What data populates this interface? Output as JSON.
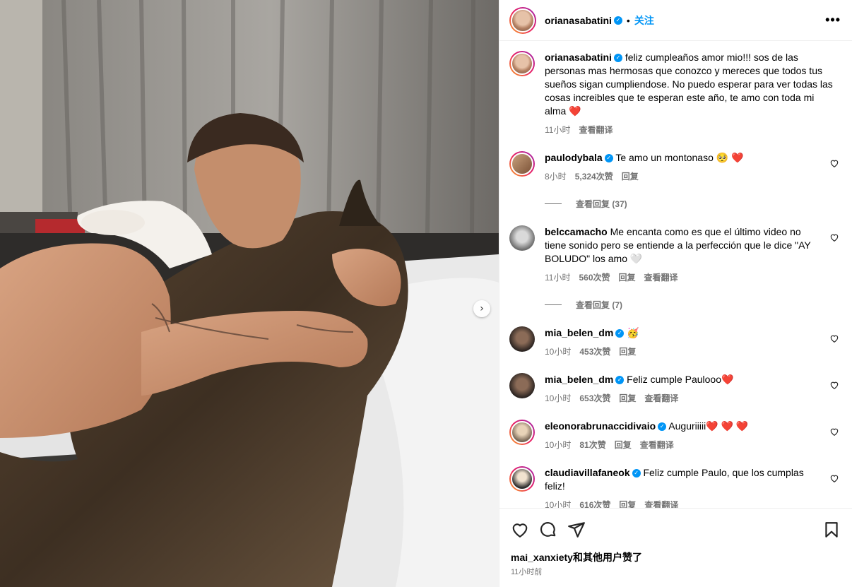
{
  "post": {
    "username": "orianasabatini",
    "follow_label": "关注",
    "more_label": "•••",
    "dot": "•"
  },
  "caption": {
    "username": "orianasabatini",
    "text": "feliz cumpleaños amor mio!!! sos de las personas mas hermosas que conozco y mereces que todos tus sueños sigan cumpliendose. No puedo esperar para ver todas las cosas increibles que te esperan este año, te amo con toda mi alma ❤️",
    "time": "11小时",
    "translate": "查看翻译"
  },
  "comments": [
    {
      "username": "paulodybala",
      "text": "Te amo un montonaso 🥺 ❤️",
      "time": "8小时",
      "likes": "5,324次赞",
      "reply": "回复",
      "translate": "",
      "view_replies": "查看回复 (37)"
    },
    {
      "username": "belccamacho",
      "text": "Me encanta como es que el último video no tiene sonido pero se entiende a la perfección que le dice \"AY BOLUDO\" los amo 🤍",
      "time": "11小时",
      "likes": "560次赞",
      "reply": "回复",
      "translate": "查看翻译",
      "view_replies": "查看回复 (7)"
    },
    {
      "username": "mia_belen_dm",
      "text": "🥳",
      "time": "10小时",
      "likes": "453次赞",
      "reply": "回复",
      "translate": "",
      "view_replies": ""
    },
    {
      "username": "mia_belen_dm",
      "text": "Feliz cumple Paulooo❤️",
      "time": "10小时",
      "likes": "653次赞",
      "reply": "回复",
      "translate": "查看翻译",
      "view_replies": ""
    },
    {
      "username": "eleonorabrunaccidivaio",
      "text": "Auguriiiii❤️ ❤️ ❤️",
      "time": "10小时",
      "likes": "81次赞",
      "reply": "回复",
      "translate": "查看翻译",
      "view_replies": ""
    },
    {
      "username": "claudiavillafaneok",
      "text": "Feliz cumple Paulo, que los cumplas feliz!",
      "time": "10小时",
      "likes": "616次赞",
      "reply": "回复",
      "translate": "查看翻译",
      "view_replies": ""
    }
  ],
  "footer": {
    "liked_by": "mai_xanxiety和其他用户赞了",
    "time": "11小时前"
  },
  "icons": {
    "verified": "✓",
    "next": "›"
  },
  "colors": {
    "accent": "#0095f6",
    "muted": "#737373",
    "heart": "#ed4956"
  }
}
